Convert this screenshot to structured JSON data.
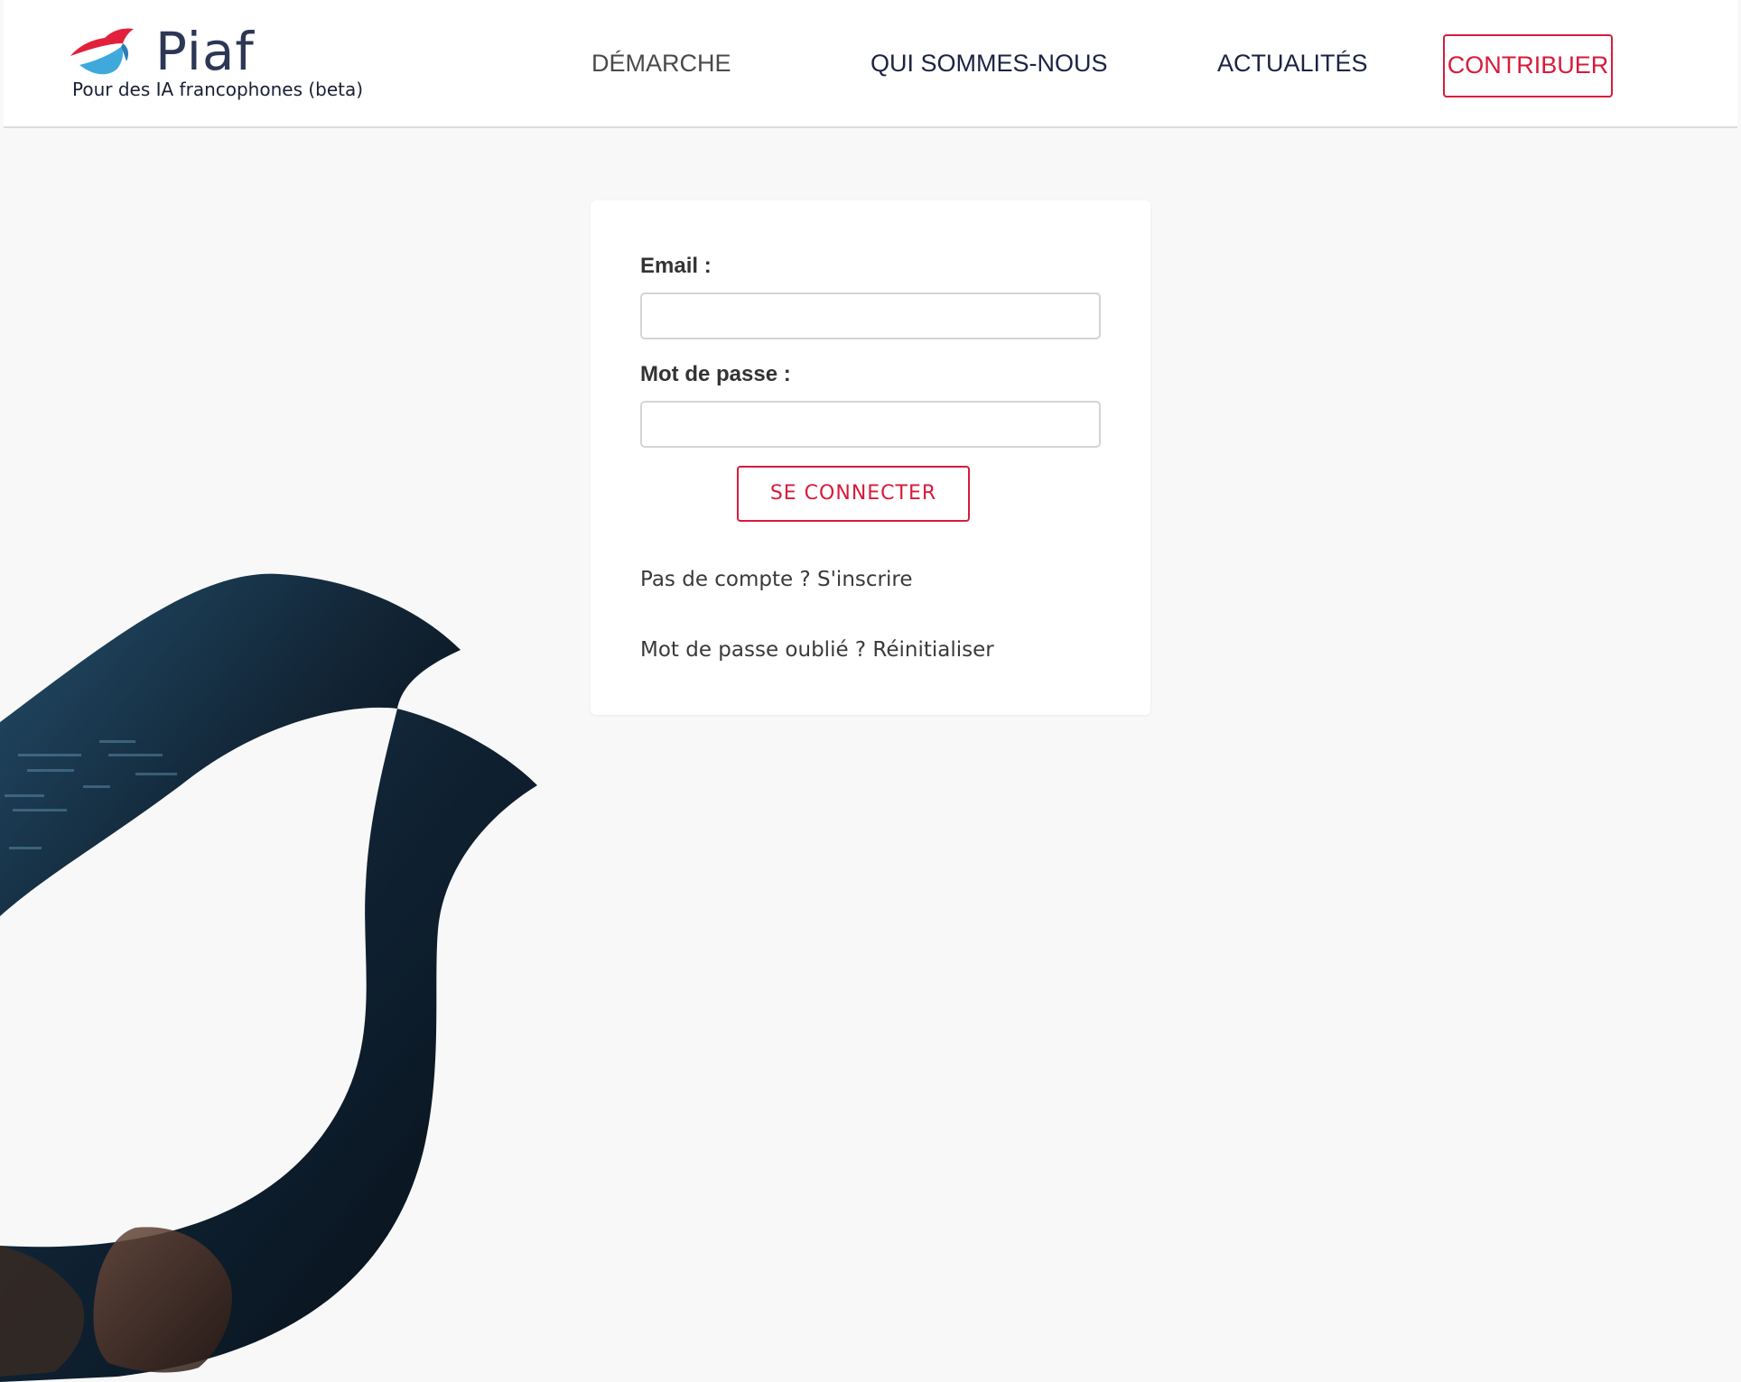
{
  "brand": {
    "name": "Piaf",
    "tagline": "Pour des IA francophones (beta)",
    "colors": {
      "accent": "#d71b3b",
      "brand_blue": "#3fa9dc",
      "brand_navy": "#2e3656"
    }
  },
  "nav": {
    "items": [
      {
        "label": "DÉMARCHE"
      },
      {
        "label": "QUI SOMMES-NOUS"
      },
      {
        "label": "ACTUALITÉS"
      }
    ],
    "cta_label": "CONTRIBUER"
  },
  "login": {
    "email_label": "Email :",
    "email_value": "",
    "password_label": "Mot de passe :",
    "password_value": "",
    "submit_label": "SE CONNECTER",
    "signup_link": "Pas de compte ? S'inscrire",
    "reset_link": "Mot de passe oublié ? Réinitialiser"
  },
  "icons": {
    "logo": "bird-logo-icon",
    "background": "bird-silhouette-photo"
  }
}
